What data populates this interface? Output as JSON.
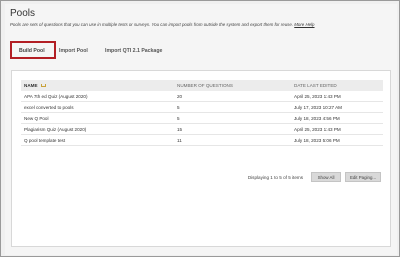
{
  "page": {
    "title": "Pools",
    "description": "Pools are sets of questions that you can use in multiple tests or surveys. You can import pools from outside the system and export them for reuse.",
    "help_link": "More Help"
  },
  "tabs": [
    {
      "label": "Build Pool"
    },
    {
      "label": "Import Pool"
    },
    {
      "label": "Import QTI 2.1 Package"
    }
  ],
  "table": {
    "headers": {
      "name": "NAME",
      "num": "NUMBER OF QUESTIONS",
      "date": "DATE LAST EDITED"
    },
    "rows": [
      {
        "name": "APA 7th ed Quiz (August 2020)",
        "num": "20",
        "date": "April 25, 2023 1:43 PM"
      },
      {
        "name": "excel converted to pools",
        "num": "5",
        "date": "July 17, 2023 10:27 AM"
      },
      {
        "name": "New Q Pool",
        "num": "5",
        "date": "July 18, 2023 4:56 PM"
      },
      {
        "name": "Plagiarism Quiz (August 2020)",
        "num": "15",
        "date": "April 25, 2023 1:43 PM"
      },
      {
        "name": "Q pool template test",
        "num": "11",
        "date": "July 18, 2023 5:06 PM"
      }
    ]
  },
  "footer": {
    "count_text": "Displaying 1 to 5 of 5 items",
    "show_all": "Show All",
    "edit_paging": "Edit Paging..."
  },
  "colors": {
    "highlight": "#b21e24"
  }
}
